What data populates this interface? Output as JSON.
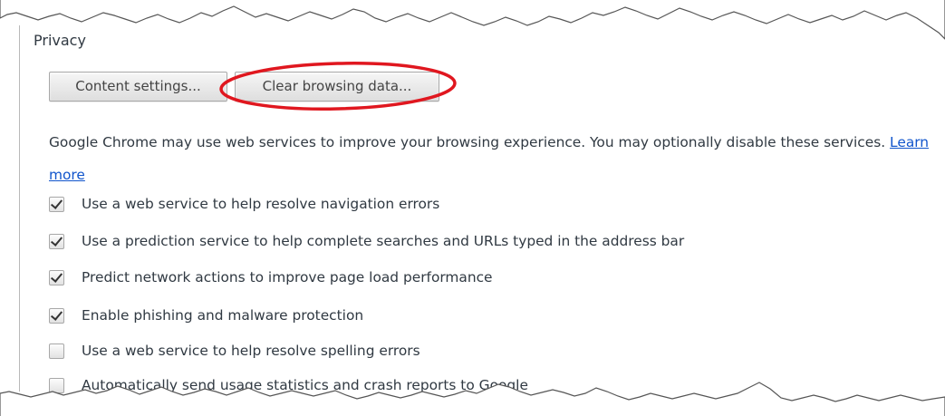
{
  "privacy": {
    "title": "Privacy",
    "buttons": {
      "content_settings": "Content settings...",
      "clear_browsing_data": "Clear browsing data..."
    },
    "description": "Google Chrome may use web services to improve your browsing experience. You may optionally disable these services.",
    "learn_more": "Learn more",
    "options": [
      {
        "label": "Use a web service to help resolve navigation errors",
        "checked": true
      },
      {
        "label": "Use a prediction service to help complete searches and URLs typed in the address bar",
        "checked": true
      },
      {
        "label": "Predict network actions to improve page load performance",
        "checked": true
      },
      {
        "label": "Enable phishing and malware protection",
        "checked": true
      },
      {
        "label": "Use a web service to help resolve spelling errors",
        "checked": false
      },
      {
        "label": "Automatically send usage statistics and crash reports to Google",
        "checked": false
      }
    ]
  },
  "colors": {
    "highlight_oval": "#e0171f",
    "link": "#1155cc",
    "text": "#303942"
  }
}
